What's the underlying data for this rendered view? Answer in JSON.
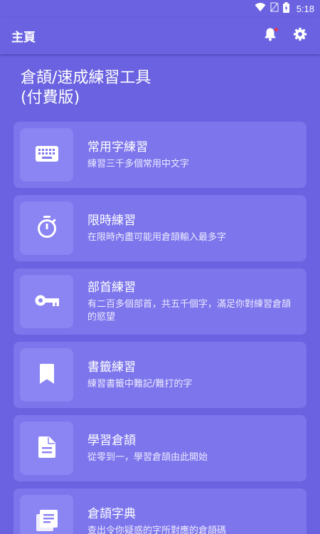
{
  "status_bar": {
    "time": "5:18",
    "icons": [
      "wifi-icon",
      "no-sim-icon",
      "battery-icon"
    ]
  },
  "app_bar": {
    "title": "主頁",
    "actions": [
      "bell-icon",
      "gear-icon"
    ]
  },
  "headline": {
    "line1": "倉頡/速成練習工具",
    "line2": "(付費版)"
  },
  "cards": [
    {
      "icon": "keyboard-icon",
      "title": "常用字練習",
      "desc": "練習三千多個常用中文字"
    },
    {
      "icon": "stopwatch-icon",
      "title": "限時練習",
      "desc": "在限時內盡可能用倉頡輸入最多字"
    },
    {
      "icon": "key-icon",
      "title": "部首練習",
      "desc": "有二百多個部首，共五千個字，滿足你對練習倉頡的慾望"
    },
    {
      "icon": "bookmark-icon",
      "title": "書籤練習",
      "desc": "練習書籤中難記/難打的字"
    },
    {
      "icon": "document-icon",
      "title": "學習倉頡",
      "desc": "從零到一，學習倉頡由此開始"
    },
    {
      "icon": "dictionary-icon",
      "title": "倉頡字典",
      "desc": "查出令你疑惑的字所對應的倉頡碼"
    }
  ],
  "colors": {
    "background": "#6a62e0",
    "card": "#7c75ec",
    "card_icon_bg": "#8b84f3",
    "notification_dot": "#e53950"
  }
}
